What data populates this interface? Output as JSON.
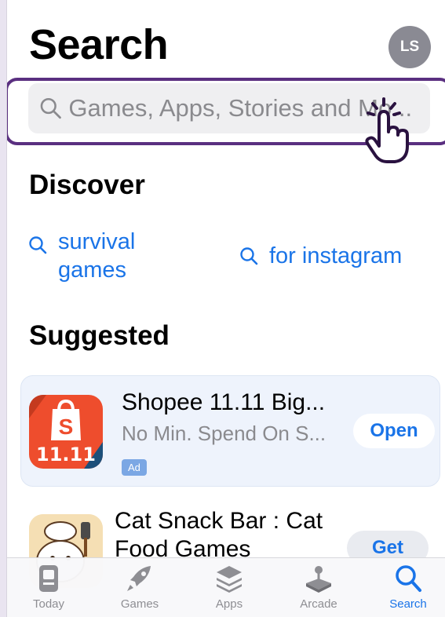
{
  "header": {
    "title": "Search",
    "avatar_initials": "LS"
  },
  "search": {
    "placeholder": "Games, Apps, Stories and Mo..."
  },
  "discover": {
    "heading": "Discover",
    "items": [
      {
        "label": "survival games"
      },
      {
        "label": "for instagram"
      }
    ]
  },
  "suggested": {
    "heading": "Suggested",
    "apps": [
      {
        "name": "Shopee 11.11 Big...",
        "subtitle": "No Min. Spend On S...",
        "badge": "Ad",
        "action": "Open",
        "icon_text": "11.11"
      },
      {
        "name_line1": "Cat Snack Bar : Cat",
        "name_line2": "Food Games",
        "action": "Get"
      }
    ]
  },
  "tabbar": {
    "tabs": [
      {
        "label": "Today",
        "icon": "today-icon"
      },
      {
        "label": "Games",
        "icon": "rocket-icon"
      },
      {
        "label": "Apps",
        "icon": "layers-icon"
      },
      {
        "label": "Arcade",
        "icon": "joystick-icon"
      },
      {
        "label": "Search",
        "icon": "search-icon"
      }
    ],
    "active": "Search"
  },
  "colors": {
    "accent": "#1a74e8",
    "highlight_outline": "#5a2f80",
    "shopee_orange": "#ee4d2d"
  }
}
